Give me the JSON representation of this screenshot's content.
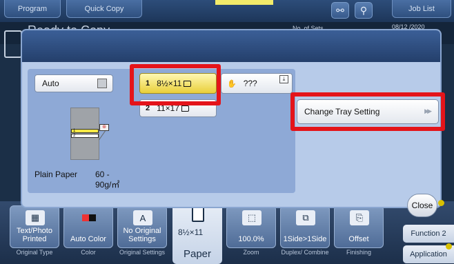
{
  "top_bar": {
    "program_label": "Program",
    "quick_copy_label": "Quick Copy",
    "job_list_label": "Job List"
  },
  "status": {
    "title": "Ready to Copy",
    "no_of_sets_label": "No. of Sets",
    "date": "08/12 /2020"
  },
  "dialog": {
    "auto_label": "Auto",
    "tray1": {
      "number": "1",
      "size": "8½×11"
    },
    "tray2": {
      "number": "2",
      "size": "11×17"
    },
    "bypass_label": "???",
    "machine_tray1": "1",
    "machine_tray2": "2",
    "paper_type": "Plain Paper",
    "paper_weight_line1": "60 -",
    "paper_weight_line2": "90g/㎡",
    "change_tray_label": "Change Tray Setting",
    "close_label": "Close"
  },
  "bottom": {
    "text_photo_label": "Text/Photo Printed",
    "auto_color_label": "Auto Color",
    "no_original_label": "No Original Settings",
    "paper_value": "8½×11",
    "paper_caption": "Paper",
    "zoom_value": "100.0%",
    "duplex_value": "1Side>1Side",
    "offset_label": "Offset",
    "cap_original_type": "Original Type",
    "cap_color": "Color",
    "cap_original_settings": "Original Settings",
    "cap_zoom": "Zoom",
    "cap_duplex": "Duplex/ Combine",
    "cap_finishing": "Finishing",
    "function2_label": "Function 2",
    "application_label": "Application"
  },
  "colors": {
    "highlight": "#e4141a",
    "selected_tray": "#f3e04a"
  }
}
